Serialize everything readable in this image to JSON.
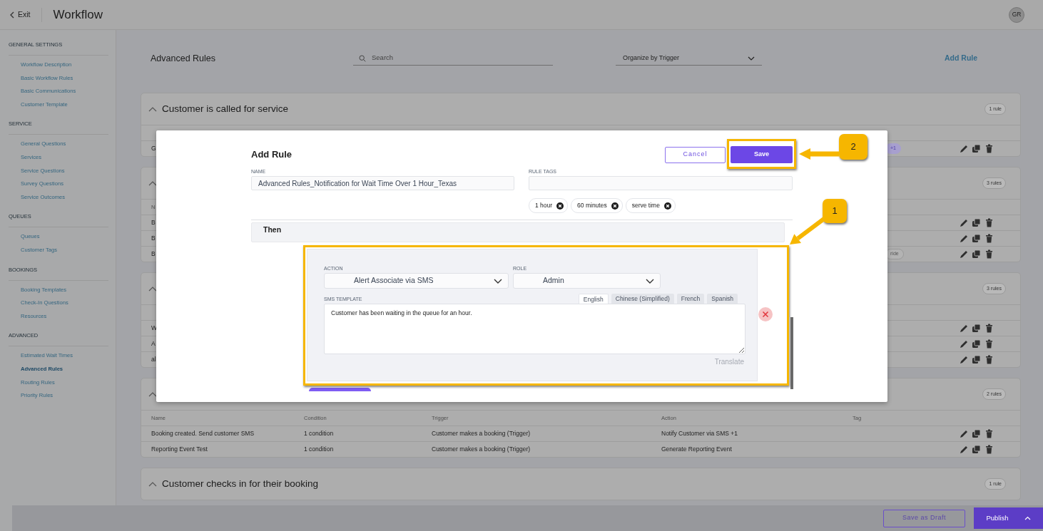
{
  "header": {
    "back": "Exit",
    "title": "Workflow",
    "avatar": "GR"
  },
  "sidebar": {
    "sections": [
      {
        "title": "GENERAL SETTINGS",
        "items": [
          {
            "label": "Workflow Description",
            "selected": false
          },
          {
            "label": "Basic Workflow Rules",
            "selected": false
          },
          {
            "label": "Basic Communications",
            "selected": false
          },
          {
            "label": "Customer Template",
            "selected": false
          }
        ]
      },
      {
        "title": "SERVICE",
        "items": [
          {
            "label": "General Questions",
            "selected": false
          },
          {
            "label": "Services",
            "selected": false
          },
          {
            "label": "Service Questions",
            "selected": false
          },
          {
            "label": "Survey Questions",
            "selected": false
          },
          {
            "label": "Service Outcomes",
            "selected": false
          }
        ]
      },
      {
        "title": "QUEUES",
        "items": [
          {
            "label": "Queues",
            "selected": false
          },
          {
            "label": "Customer Tags",
            "selected": false
          }
        ]
      },
      {
        "title": "BOOKINGS",
        "items": [
          {
            "label": "Booking Templates",
            "selected": false
          },
          {
            "label": "Check-In Questions",
            "selected": false
          },
          {
            "label": "Resources",
            "selected": false
          }
        ]
      },
      {
        "title": "ADVANCED",
        "items": [
          {
            "label": "Estimated Wait Times",
            "selected": false
          },
          {
            "label": "Advanced Rules",
            "selected": true
          },
          {
            "label": "Routing Rules",
            "selected": false
          },
          {
            "label": "Priority Rules",
            "selected": false
          }
        ]
      }
    ]
  },
  "toolbar": {
    "title": "Advanced Rules",
    "search": {
      "placeholder": "Search"
    },
    "organize": "Organize by Trigger",
    "add_rule": "Add Rule"
  },
  "groups": [
    {
      "title": "Customer is called for service",
      "count": "1 rule",
      "rows": [
        {
          "cells": [
            "G"
          ],
          "tags": [
            {
              "label": "+1",
              "kind": "more"
            }
          ]
        }
      ]
    },
    {
      "count": "3 rules",
      "columns": [
        "N"
      ],
      "rows": [
        {
          "cells": [
            "B"
          ]
        },
        {
          "cells": [
            "B"
          ]
        },
        {
          "cells": [
            "B"
          ],
          "tags": [
            {
              "label": "ride",
              "kind": "tag"
            }
          ]
        }
      ]
    },
    {
      "count": "3 rules",
      "rows": [
        {
          "cells": [
            "W"
          ]
        },
        {
          "cells": [
            "A"
          ]
        },
        {
          "cells": [
            "al"
          ]
        }
      ]
    },
    {
      "count": "2 rules",
      "columns": [
        "Name",
        "Condition",
        "Trigger",
        "Action",
        "Tag"
      ],
      "rows": [
        {
          "cells": [
            "Booking created. Send customer SMS",
            "1 condition",
            "Customer makes a booking (Trigger)",
            "Notify Customer via SMS +1"
          ]
        },
        {
          "cells": [
            "Reporting Event Test",
            "1 condition",
            "Customer makes a booking (Trigger)",
            "Generate Reporting Event"
          ]
        }
      ]
    },
    {
      "title": "Customer checks in for their booking",
      "count": "1 rule"
    }
  ],
  "modal": {
    "title": "Add Rule",
    "cancel": "Cancel",
    "save": "Save",
    "name": {
      "label": "NAME",
      "value": "Advanced Rules_Notification for Wait Time Over 1 Hour_Texas"
    },
    "rule_tags": {
      "label": "RULE TAGS",
      "tags": [
        "1 hour",
        "60 minutes",
        "serve time"
      ]
    },
    "section": "Then",
    "action": {
      "label": "ACTION",
      "value": "Alert Associate via SMS"
    },
    "role": {
      "label": "ROLE",
      "value": "Admin"
    },
    "sms_template": {
      "label": "SMS TEMPLATE",
      "languages": [
        {
          "label": "English",
          "selected": true
        },
        {
          "label": "Chinese (Simplified)",
          "selected": false
        },
        {
          "label": "French",
          "selected": false
        },
        {
          "label": "Spanish",
          "selected": false
        }
      ],
      "value": "Customer has been waiting in the queue for an hour.",
      "translate": "Translate"
    }
  },
  "callouts": [
    {
      "number": "1"
    },
    {
      "number": "2"
    }
  ],
  "footer": {
    "save_draft": "Save as Draft",
    "publish": "Publish"
  }
}
